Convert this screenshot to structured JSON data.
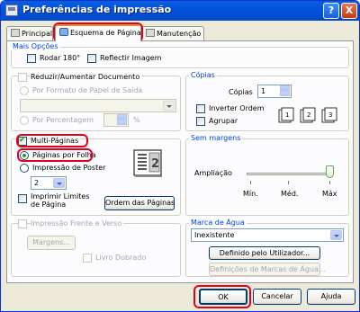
{
  "window": {
    "title": "Preferências de impressão",
    "help_btn": "?",
    "close_btn": "X"
  },
  "tabs": [
    {
      "label": "Principal",
      "icon": "printer-icon"
    },
    {
      "label": "Esquema de Página",
      "icon": "page-layout-icon"
    },
    {
      "label": "Manutenção",
      "icon": "toolbox-icon"
    }
  ],
  "mais_opcoes": {
    "title": "Mais Opções",
    "rodar": "Rodar 180°",
    "reflectir": "Reflectir Imagem"
  },
  "reduzir": {
    "label": "Reduzir/Aumentar Documento",
    "formato": "Por Formato de Papel de Saída",
    "percentagem": "Por Percentagem"
  },
  "copias": {
    "title": "Cópias",
    "label": "Cópias",
    "value": "1",
    "inverter": "Inverter Ordem",
    "agrupar": "Agrupar",
    "collate_icons": [
      "1",
      "2",
      "3"
    ]
  },
  "multi": {
    "label": "Multi-Páginas",
    "paginas_folha": "Páginas por Folha",
    "poster": "Impressão de Poster",
    "count": "2",
    "imprimir_limites_1": "Imprimir Limites",
    "imprimir_limites_2": "de Página",
    "ordem_btn": "Ordem das Páginas",
    "preview_number": "2"
  },
  "sem_margens": {
    "title": "Sem margens",
    "ampliacao": "Ampliação",
    "min": "Mín.",
    "med": "Méd.",
    "max": "Máx",
    "level": "max"
  },
  "frente_verso": {
    "label": "Impressão Frente e Verso",
    "margens_btn": "Margens...",
    "livro": "Livro Dobrado"
  },
  "marca": {
    "title": "Marca de Água",
    "value": "Inexistente",
    "definido_btn": "Definido pelo Utilizador...",
    "definicoes_btn": "Definições de Marcas de Água..."
  },
  "footer": {
    "ok": "OK",
    "cancel": "Cancelar",
    "help": "Ajuda"
  },
  "colors": {
    "highlight": "#e3001b",
    "titlebar": "#0353e0",
    "group_title": "#0046d5"
  }
}
